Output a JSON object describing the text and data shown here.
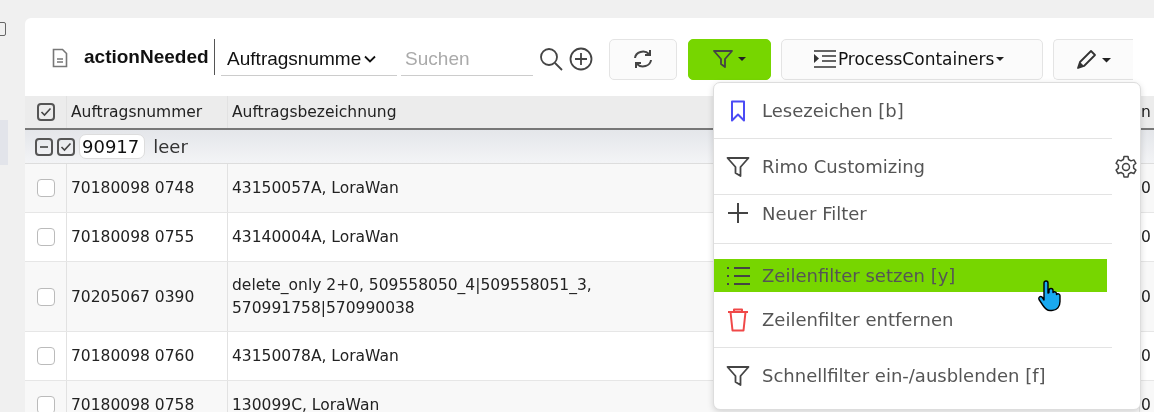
{
  "toolbar": {
    "title": "actionNeeded",
    "field_select": {
      "value": "Auftragsnumme"
    },
    "search": {
      "placeholder": "Suchen"
    },
    "filter_button": {
      "active": true
    },
    "process_button": {
      "label": "ProcessContainers"
    }
  },
  "table": {
    "header_checked": true,
    "columns": [
      "Auftragsnummer",
      "Auftragsbezeichnung",
      "n"
    ],
    "group": {
      "expanded": true,
      "checked": true,
      "key": "90917",
      "label": "leer"
    },
    "rows": [
      {
        "checked": false,
        "cells": [
          "70180098 0748",
          "43150057A, LoraWan",
          "0"
        ]
      },
      {
        "checked": false,
        "cells": [
          "70180098 0755",
          "43140004A, LoraWan",
          "0"
        ]
      },
      {
        "checked": false,
        "cells": [
          "70205067 0390",
          "delete_only 2+0, 509558050_4|509558051_3, 570991758|570990038",
          "0"
        ]
      },
      {
        "checked": false,
        "cells": [
          "70180098 0760",
          "43150078A, LoraWan",
          "0"
        ]
      },
      {
        "checked": false,
        "cells": [
          "70180098 0758",
          "130099C, LoraWan",
          "0"
        ]
      }
    ]
  },
  "menu": {
    "items": [
      {
        "kind": "bookmark",
        "label": "Lesezeichen [b]",
        "selected": false,
        "gear": false,
        "divider_after": true
      },
      {
        "kind": "filter",
        "label": "Rimo Customizing",
        "selected": false,
        "gear": true,
        "divider_after": true
      },
      {
        "kind": "plus",
        "label": "Neuer Filter",
        "selected": false,
        "gear": false,
        "divider_after": true
      },
      {
        "kind": "list",
        "label": "Zeilenfilter setzen [y]",
        "selected": true,
        "gear": false,
        "divider_after": false
      },
      {
        "kind": "trash",
        "label": "Zeilenfilter entfernen",
        "selected": false,
        "gear": false,
        "divider_after": true
      },
      {
        "kind": "filter",
        "label": "Schnellfilter ein-/ausblenden [f]",
        "selected": false,
        "gear": false,
        "divider_after": false
      }
    ]
  }
}
